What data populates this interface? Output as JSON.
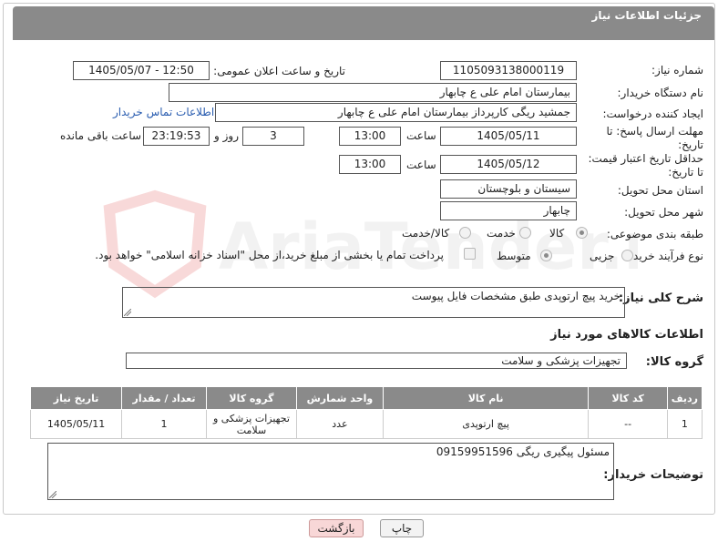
{
  "header": {
    "title": "جزئیات اطلاعات نیاز"
  },
  "labels": {
    "need_number": "شماره نیاز:",
    "announce_datetime": "تاریخ و ساعت اعلان عمومی:",
    "buyer_org": "نام دستگاه خریدار:",
    "creator": "ایجاد کننده درخواست:",
    "buyer_contact_link": "اطلاعات تماس خریدار",
    "reply_deadline": "مهلت ارسال پاسخ: تا تاریخ:",
    "hour": "ساعت",
    "day_and": "روز و",
    "hours_remaining": "ساعت باقی مانده",
    "price_validity": "حداقل تاریخ اعتبار قیمت: تا تاریخ:",
    "delivery_province": "استان محل تحویل:",
    "delivery_city": "شهر محل تحویل:",
    "category": "طبقه بندی موضوعی:",
    "purchase_process": "نوع فرآیند خرید :",
    "general_desc": "شرح کلی نیاز:",
    "goods_info": "اطلاعات کالاهای مورد نیاز",
    "goods_group": "گروه کالا:",
    "buyer_notes": "توضیحات خریدار:"
  },
  "values": {
    "need_number": "1105093138000119",
    "announce_datetime": "1405/05/07 - 12:50",
    "buyer_org": "بیمارستان امام علی  ع  چابهار",
    "creator": "جمشید ریگی کارپرداز بیمارستان امام علی  ع  چابهار",
    "reply_date": "1405/05/11",
    "reply_time": "13:00",
    "reply_days": "3",
    "remaining_time": "23:19:53",
    "validity_date": "1405/05/12",
    "validity_time": "13:00",
    "delivery_province": "سیستان و بلوچستان",
    "delivery_city": "چابهار",
    "general_desc": "خرید پیچ ارتوپدی طبق مشخصات فایل پیوست",
    "goods_group": "تجهیزات پزشکی و سلامت",
    "buyer_notes": "مسئول پیگیری ریگی 09159951596"
  },
  "category_options": [
    {
      "label": "کالا",
      "selected": true
    },
    {
      "label": "خدمت",
      "selected": false
    },
    {
      "label": "کالا/خدمت",
      "selected": false
    }
  ],
  "process_options": [
    {
      "label": "جزیی",
      "selected": false
    },
    {
      "label": "متوسط",
      "selected": true
    }
  ],
  "treasury_note": "پرداخت تمام یا بخشی از مبلغ خرید،از محل \"اسناد خزانه اسلامی\" خواهد بود.",
  "table": {
    "headers": [
      "ردیف",
      "کد کالا",
      "نام کالا",
      "واحد شمارش",
      "گروه کالا",
      "تعداد / مقدار",
      "تاریخ نیاز"
    ],
    "rows": [
      [
        "1",
        "--",
        "پیچ ارتوپدی",
        "عدد",
        "تجهیزات پزشکی و سلامت",
        "1",
        "1405/05/11"
      ]
    ]
  },
  "buttons": {
    "print": "چاپ",
    "back": "بازگشت"
  },
  "watermark": {
    "text": "AriaTender.net"
  },
  "colors": {
    "header_bg": "#8a8a8a",
    "link": "#2a5db0",
    "back_btn": "#f8d7d7"
  }
}
